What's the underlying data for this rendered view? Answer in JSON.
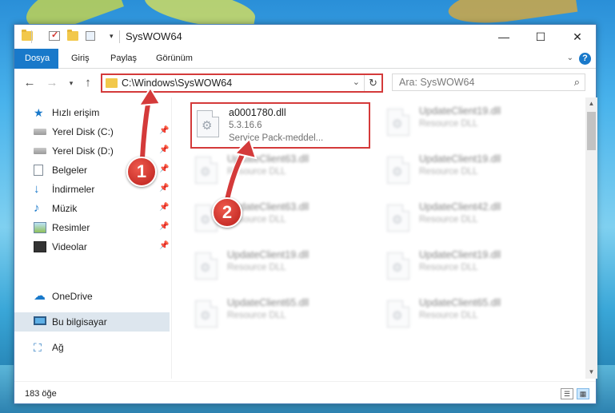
{
  "window": {
    "title": "SysWOW64",
    "controls": {
      "minimize": "—",
      "maximize": "☐",
      "close": "✕"
    }
  },
  "ribbon": {
    "tabs": [
      "Dosya",
      "Giriş",
      "Paylaş",
      "Görünüm"
    ],
    "active_tab": "Dosya"
  },
  "address": {
    "path": "C:\\Windows\\SysWOW64",
    "refresh_icon": "↻",
    "search_placeholder": "Ara: SysWOW64"
  },
  "nav_pane": {
    "items": [
      {
        "label": "Hızlı erişim",
        "icon": "star-icon",
        "pinned": false
      },
      {
        "label": "Yerel Disk (C:)",
        "icon": "drive-icon",
        "pinned": true
      },
      {
        "label": "Yerel Disk (D:)",
        "icon": "drive-icon",
        "pinned": true
      },
      {
        "label": "Belgeler",
        "icon": "documents-icon",
        "pinned": true
      },
      {
        "label": "İndirmeler",
        "icon": "downloads-icon",
        "pinned": true
      },
      {
        "label": "Müzik",
        "icon": "music-icon",
        "pinned": true
      },
      {
        "label": "Resimler",
        "icon": "pictures-icon",
        "pinned": true
      },
      {
        "label": "Videolar",
        "icon": "videos-icon",
        "pinned": true
      },
      {
        "label": "OneDrive",
        "icon": "onedrive-icon",
        "pinned": false
      },
      {
        "label": "Bu bilgisayar",
        "icon": "this-pc-icon",
        "pinned": false,
        "selected": true
      },
      {
        "label": "Ağ",
        "icon": "network-icon",
        "pinned": false
      }
    ]
  },
  "files": {
    "highlighted": {
      "name": "a0001780.dll",
      "version": "5.3.16.6",
      "description": "Service Pack-meddel..."
    },
    "items": [
      {
        "name": "UpdateClient19.dll",
        "description": "Resource DLL"
      },
      {
        "name": "UpdateClient63.dll",
        "description": "Resource DLL"
      },
      {
        "name": "UpdateClient19.dll",
        "description": "Resource DLL"
      },
      {
        "name": "UpdateClient63.dll",
        "description": "Resource DLL"
      },
      {
        "name": "UpdateClient42.dll",
        "description": "Resource DLL"
      },
      {
        "name": "UpdateClient19.dll",
        "description": "Resource DLL"
      },
      {
        "name": "UpdateClient19.dll",
        "description": "Resource DLL"
      },
      {
        "name": "UpdateClient65.dll",
        "description": "Resource DLL"
      },
      {
        "name": "UpdateClient65.dll",
        "description": "Resource DLL"
      }
    ]
  },
  "status": {
    "item_count": "183 öğe"
  },
  "annotations": {
    "step1": "1",
    "step2": "2",
    "color": "#d43a3a"
  }
}
